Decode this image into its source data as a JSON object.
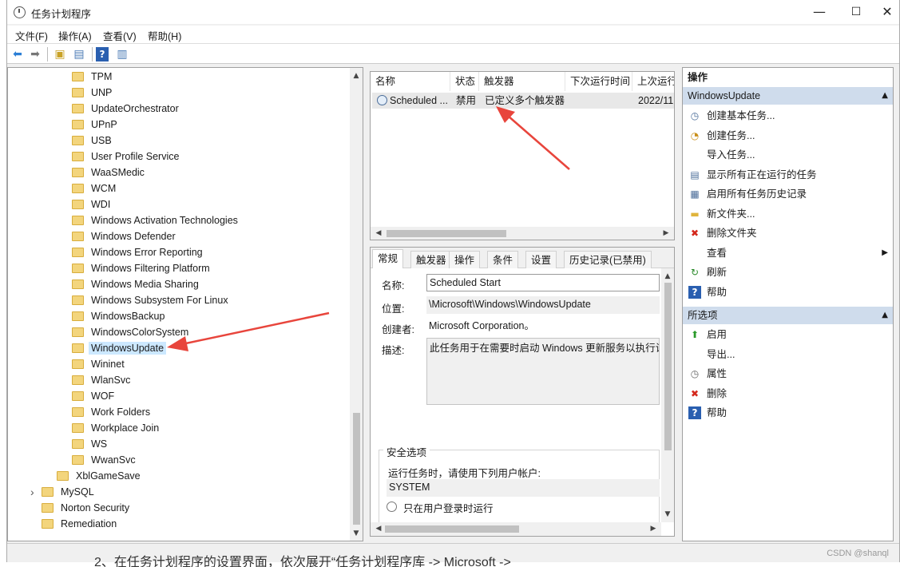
{
  "window": {
    "title": "任务计划程序",
    "minimize_glyph": "—",
    "maximize_glyph": "☐",
    "close_glyph": "✕"
  },
  "menu": [
    "文件(F)",
    "操作(A)",
    "查看(V)",
    "帮助(H)"
  ],
  "tree": {
    "items": [
      "TPM",
      "UNP",
      "UpdateOrchestrator",
      "UPnP",
      "USB",
      "User Profile Service",
      "WaaSMedic",
      "WCM",
      "WDI",
      "Windows Activation Technologies",
      "Windows Defender",
      "Windows Error Reporting",
      "Windows Filtering Platform",
      "Windows Media Sharing",
      "Windows Subsystem For Linux",
      "WindowsBackup",
      "WindowsColorSystem",
      "WindowsUpdate",
      "Wininet",
      "WlanSvc",
      "WOF",
      "Work Folders",
      "Workplace Join",
      "WS",
      "WwanSvc"
    ],
    "selected": "WindowsUpdate",
    "parent_items": [
      "XblGameSave"
    ],
    "root_items": [
      "MySQL",
      "Norton Security",
      "Remediation"
    ]
  },
  "task_list": {
    "columns": [
      "名称",
      "状态",
      "触发器",
      "下次运行时间",
      "上次运行"
    ],
    "row": [
      "Scheduled ...",
      "禁用",
      "已定义多个触发器",
      "",
      "2022/11"
    ]
  },
  "details": {
    "tabs": [
      "常规",
      "触发器",
      "操作",
      "条件",
      "设置",
      "历史记录(已禁用)"
    ],
    "name_label": "名称:",
    "name_value": "Scheduled Start",
    "location_label": "位置:",
    "location_value": "\\Microsoft\\Windows\\WindowsUpdate",
    "author_label": "创建者:",
    "author_value": "Microsoft Corporation。",
    "description_label": "描述:",
    "description_value": "此任务用于在需要时启动 Windows 更新服务以执行计",
    "security_title": "安全选项",
    "run_as_text": "运行任务时，请使用下列用户帐户:",
    "account": "SYSTEM",
    "radio_label": "只在用户登录时运行"
  },
  "actions": {
    "header": "操作",
    "section1": "WindowsUpdate",
    "items1": [
      {
        "label": "创建基本任务...",
        "icon": "clock-icon"
      },
      {
        "label": "创建任务...",
        "icon": "task-icon"
      },
      {
        "label": "导入任务...",
        "icon": ""
      },
      {
        "label": "显示所有正在运行的任务",
        "icon": "list-icon"
      },
      {
        "label": "启用所有任务历史记录",
        "icon": "history-icon"
      },
      {
        "label": "新文件夹...",
        "icon": "folder-icon"
      },
      {
        "label": "删除文件夹",
        "icon": "delete-icon"
      },
      {
        "label": "查看",
        "icon": ""
      },
      {
        "label": "刷新",
        "icon": "refresh-icon"
      },
      {
        "label": "帮助",
        "icon": "help-icon"
      }
    ],
    "section2": "所选项",
    "items2": [
      {
        "label": "启用",
        "icon": "up-arrow-icon"
      },
      {
        "label": "导出...",
        "icon": ""
      },
      {
        "label": "属性",
        "icon": "properties-icon"
      },
      {
        "label": "删除",
        "icon": "delete-icon"
      },
      {
        "label": "帮助",
        "icon": "help-icon"
      }
    ]
  },
  "watermark": "CSDN @shanql",
  "caption": "2、在任务计划程序的设置界面，依次展开“任务计划程序库 -> Microsoft ->",
  "colors": {
    "arrow": "#e8453c",
    "section_bg": "#cfdcec",
    "selection": "#cce8ff"
  }
}
